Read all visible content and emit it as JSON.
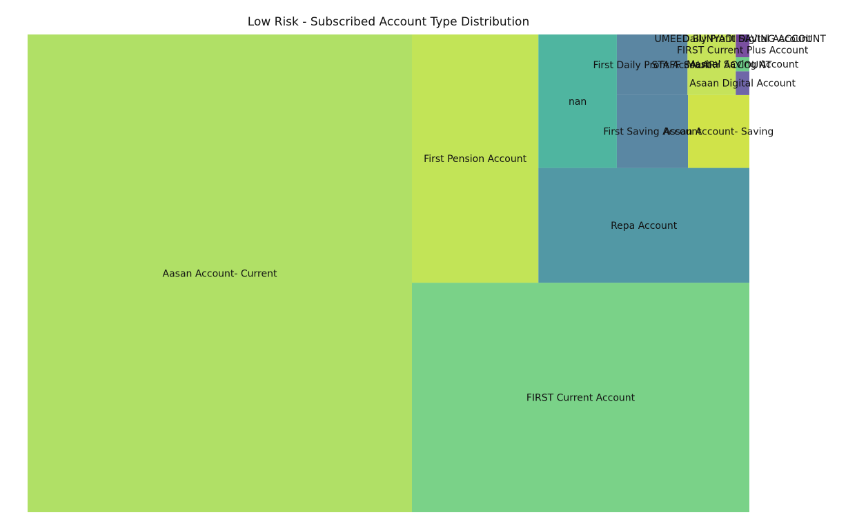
{
  "chart_data": {
    "type": "treemap",
    "title": "Low Risk - Subscribed Account Type Distribution",
    "xlabel": "",
    "ylabel": "",
    "axis": "off",
    "items": [
      {
        "label": "Aasan Account- Current",
        "value": 386000,
        "color": "#b0e066"
      },
      {
        "label": "FIRST Current Account",
        "value": 162800,
        "color": "#7ad288"
      },
      {
        "label": "First  Pension Account",
        "value": 66000,
        "color": "#c2e457"
      },
      {
        "label": "Repa Account",
        "value": 50900,
        "color": "#5298a5"
      },
      {
        "label": "nan",
        "value": 22000,
        "color": "#4fb5a0"
      },
      {
        "label": "First Saving Account",
        "value": 10900,
        "color": "#5a87a3"
      },
      {
        "label": "Assan Account- Saving",
        "value": 9400,
        "color": "#d0e349"
      },
      {
        "label": "First Daily Profit Account",
        "value": 9000,
        "color": "#5b86a2"
      },
      {
        "label": "STAFF SALARY ACCOUNT",
        "value": 6150,
        "color": "#c6e35a"
      },
      {
        "label": "Asaan Digital Account",
        "value": 680,
        "color": "#6f66a8"
      },
      {
        "label": "Mashal Saving Account",
        "value": 400,
        "color": "#6fcc8a"
      },
      {
        "label": "FIRST Current Plus Account",
        "value": 420,
        "color": "#7a4fa0"
      },
      {
        "label": "UMEED BUNYADI SAVING ACCOUNT",
        "value": 150,
        "color": "#6a3d90"
      },
      {
        "label": "Daily Profit Digital Account",
        "value": 80,
        "color": "#5c3a8a"
      }
    ]
  }
}
